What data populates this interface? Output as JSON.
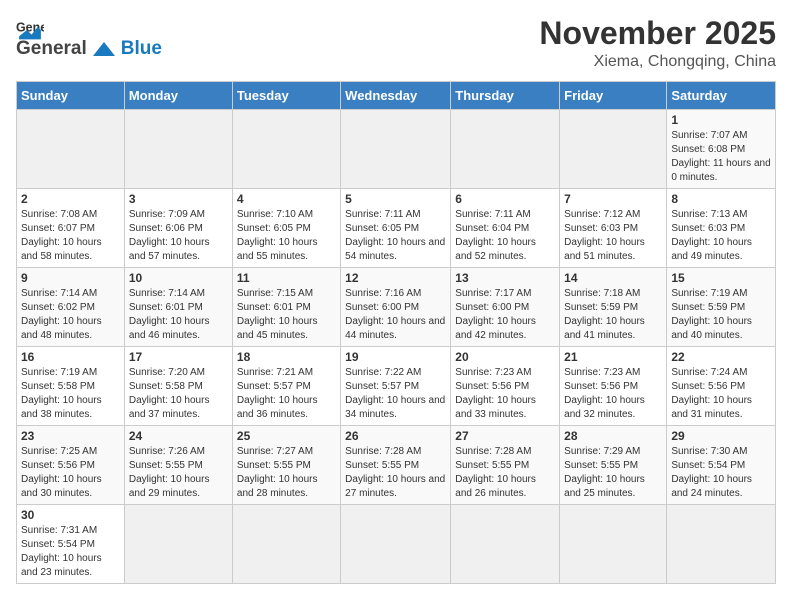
{
  "header": {
    "logo_general": "General",
    "logo_blue": "Blue",
    "month_title": "November 2025",
    "location": "Xiema, Chongqing, China"
  },
  "days_of_week": [
    "Sunday",
    "Monday",
    "Tuesday",
    "Wednesday",
    "Thursday",
    "Friday",
    "Saturday"
  ],
  "weeks": [
    [
      {
        "day": "",
        "info": ""
      },
      {
        "day": "",
        "info": ""
      },
      {
        "day": "",
        "info": ""
      },
      {
        "day": "",
        "info": ""
      },
      {
        "day": "",
        "info": ""
      },
      {
        "day": "",
        "info": ""
      },
      {
        "day": "1",
        "info": "Sunrise: 7:07 AM\nSunset: 6:08 PM\nDaylight: 11 hours and 0 minutes."
      }
    ],
    [
      {
        "day": "2",
        "info": "Sunrise: 7:08 AM\nSunset: 6:07 PM\nDaylight: 10 hours and 58 minutes."
      },
      {
        "day": "3",
        "info": "Sunrise: 7:09 AM\nSunset: 6:06 PM\nDaylight: 10 hours and 57 minutes."
      },
      {
        "day": "4",
        "info": "Sunrise: 7:10 AM\nSunset: 6:05 PM\nDaylight: 10 hours and 55 minutes."
      },
      {
        "day": "5",
        "info": "Sunrise: 7:11 AM\nSunset: 6:05 PM\nDaylight: 10 hours and 54 minutes."
      },
      {
        "day": "6",
        "info": "Sunrise: 7:11 AM\nSunset: 6:04 PM\nDaylight: 10 hours and 52 minutes."
      },
      {
        "day": "7",
        "info": "Sunrise: 7:12 AM\nSunset: 6:03 PM\nDaylight: 10 hours and 51 minutes."
      },
      {
        "day": "8",
        "info": "Sunrise: 7:13 AM\nSunset: 6:03 PM\nDaylight: 10 hours and 49 minutes."
      }
    ],
    [
      {
        "day": "9",
        "info": "Sunrise: 7:14 AM\nSunset: 6:02 PM\nDaylight: 10 hours and 48 minutes."
      },
      {
        "day": "10",
        "info": "Sunrise: 7:14 AM\nSunset: 6:01 PM\nDaylight: 10 hours and 46 minutes."
      },
      {
        "day": "11",
        "info": "Sunrise: 7:15 AM\nSunset: 6:01 PM\nDaylight: 10 hours and 45 minutes."
      },
      {
        "day": "12",
        "info": "Sunrise: 7:16 AM\nSunset: 6:00 PM\nDaylight: 10 hours and 44 minutes."
      },
      {
        "day": "13",
        "info": "Sunrise: 7:17 AM\nSunset: 6:00 PM\nDaylight: 10 hours and 42 minutes."
      },
      {
        "day": "14",
        "info": "Sunrise: 7:18 AM\nSunset: 5:59 PM\nDaylight: 10 hours and 41 minutes."
      },
      {
        "day": "15",
        "info": "Sunrise: 7:19 AM\nSunset: 5:59 PM\nDaylight: 10 hours and 40 minutes."
      }
    ],
    [
      {
        "day": "16",
        "info": "Sunrise: 7:19 AM\nSunset: 5:58 PM\nDaylight: 10 hours and 38 minutes."
      },
      {
        "day": "17",
        "info": "Sunrise: 7:20 AM\nSunset: 5:58 PM\nDaylight: 10 hours and 37 minutes."
      },
      {
        "day": "18",
        "info": "Sunrise: 7:21 AM\nSunset: 5:57 PM\nDaylight: 10 hours and 36 minutes."
      },
      {
        "day": "19",
        "info": "Sunrise: 7:22 AM\nSunset: 5:57 PM\nDaylight: 10 hours and 34 minutes."
      },
      {
        "day": "20",
        "info": "Sunrise: 7:23 AM\nSunset: 5:56 PM\nDaylight: 10 hours and 33 minutes."
      },
      {
        "day": "21",
        "info": "Sunrise: 7:23 AM\nSunset: 5:56 PM\nDaylight: 10 hours and 32 minutes."
      },
      {
        "day": "22",
        "info": "Sunrise: 7:24 AM\nSunset: 5:56 PM\nDaylight: 10 hours and 31 minutes."
      }
    ],
    [
      {
        "day": "23",
        "info": "Sunrise: 7:25 AM\nSunset: 5:56 PM\nDaylight: 10 hours and 30 minutes."
      },
      {
        "day": "24",
        "info": "Sunrise: 7:26 AM\nSunset: 5:55 PM\nDaylight: 10 hours and 29 minutes."
      },
      {
        "day": "25",
        "info": "Sunrise: 7:27 AM\nSunset: 5:55 PM\nDaylight: 10 hours and 28 minutes."
      },
      {
        "day": "26",
        "info": "Sunrise: 7:28 AM\nSunset: 5:55 PM\nDaylight: 10 hours and 27 minutes."
      },
      {
        "day": "27",
        "info": "Sunrise: 7:28 AM\nSunset: 5:55 PM\nDaylight: 10 hours and 26 minutes."
      },
      {
        "day": "28",
        "info": "Sunrise: 7:29 AM\nSunset: 5:55 PM\nDaylight: 10 hours and 25 minutes."
      },
      {
        "day": "29",
        "info": "Sunrise: 7:30 AM\nSunset: 5:54 PM\nDaylight: 10 hours and 24 minutes."
      }
    ],
    [
      {
        "day": "30",
        "info": "Sunrise: 7:31 AM\nSunset: 5:54 PM\nDaylight: 10 hours and 23 minutes."
      },
      {
        "day": "",
        "info": ""
      },
      {
        "day": "",
        "info": ""
      },
      {
        "day": "",
        "info": ""
      },
      {
        "day": "",
        "info": ""
      },
      {
        "day": "",
        "info": ""
      },
      {
        "day": "",
        "info": ""
      }
    ]
  ]
}
